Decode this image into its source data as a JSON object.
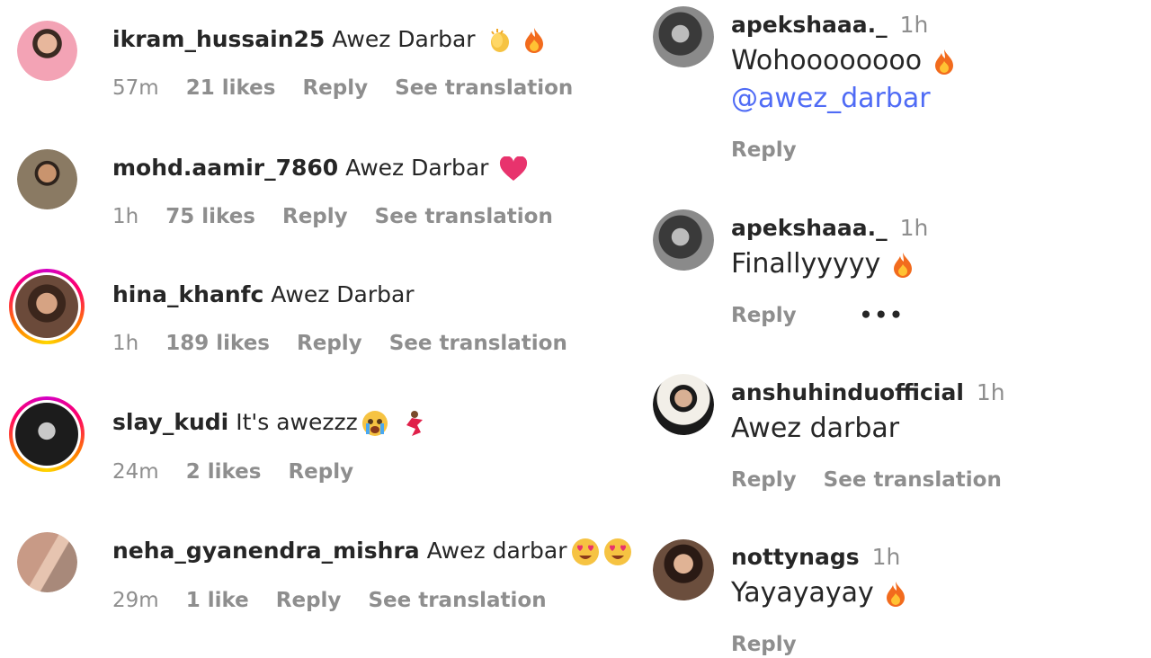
{
  "left_comments": [
    {
      "username": "ikram_hussain25",
      "text": "Awez Darbar",
      "emoji": [
        "clap-icon",
        "fire-icon"
      ],
      "time": "57m",
      "likes": "21 likes",
      "reply": "Reply",
      "translate": "See translation",
      "avatar_color": "#f3a3b5"
    },
    {
      "username": "mohd.aamir_7860",
      "text": "Awez Darbar",
      "emoji": [
        "heart-icon"
      ],
      "time": "1h",
      "likes": "75 likes",
      "reply": "Reply",
      "translate": "See translation",
      "avatar_color": "#8a7a63"
    },
    {
      "username": "hina_khanfc",
      "text": "Awez Darbar",
      "emoji": [],
      "time": "1h",
      "likes": "189 likes",
      "reply": "Reply",
      "translate": "See translation",
      "avatar_color": "#6b4a3a"
    },
    {
      "username": "slay_kudi",
      "text": "It's awezzz",
      "emoji": [
        "crying-face-icon",
        "dancer-icon"
      ],
      "time": "24m",
      "likes": "2 likes",
      "reply": "Reply",
      "avatar_color": "#2b2b2b"
    },
    {
      "username": "neha_gyanendra_mishra",
      "text": "Awez darbar",
      "emoji": [
        "heart-eyes-icon",
        "heart-eyes-icon"
      ],
      "time": "29m",
      "likes": "1 like",
      "reply": "Reply",
      "translate": "See translation",
      "avatar_color": "#a8897a"
    }
  ],
  "right_comments": [
    {
      "username": "apekshaaa._",
      "time": "1h",
      "text": "Wohoooooooo",
      "mention": "@awez_darbar",
      "reply": "Reply",
      "avatar_color": "#555"
    },
    {
      "username": "apekshaaa._",
      "time": "1h",
      "text": "Finallyyyyy",
      "reply": "Reply",
      "more": "•••",
      "avatar_color": "#555"
    },
    {
      "username": "anshuhinduofficial",
      "time": "1h",
      "text": "Awez darbar",
      "reply": "Reply",
      "translate": "See translation",
      "avatar_color": "#1a1a1a"
    },
    {
      "username": "nottynags",
      "time": "1h",
      "text": "Yayayayay",
      "reply": "Reply",
      "avatar_color": "#6b4e3d"
    }
  ],
  "colors": {
    "text": "#262626",
    "muted": "#8e8e8e",
    "mention": "#4f6bf5",
    "fire": "#f26b1d",
    "heart": "#e8336d"
  }
}
